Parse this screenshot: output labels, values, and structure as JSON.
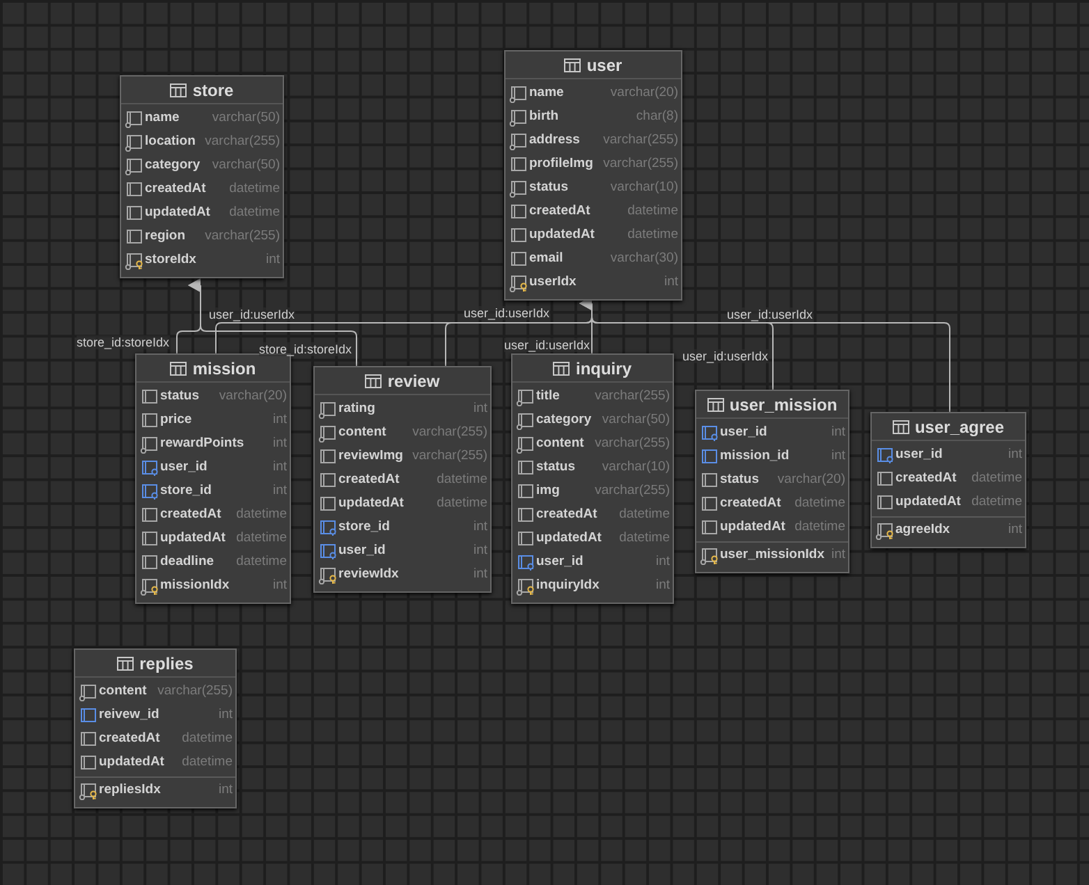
{
  "tables": [
    {
      "name": "store",
      "key_divider": false,
      "columns": [
        {
          "name": "name",
          "type": "varchar(50)",
          "kind": "required"
        },
        {
          "name": "location",
          "type": "varchar(255)",
          "kind": "required"
        },
        {
          "name": "category",
          "type": "varchar(50)",
          "kind": "required"
        },
        {
          "name": "createdAt",
          "type": "datetime",
          "kind": "plain"
        },
        {
          "name": "updatedAt",
          "type": "datetime",
          "kind": "plain"
        },
        {
          "name": "region",
          "type": "varchar(255)",
          "kind": "plain"
        },
        {
          "name": "storeIdx",
          "type": "int",
          "kind": "primary"
        }
      ]
    },
    {
      "name": "user",
      "key_divider": false,
      "columns": [
        {
          "name": "name",
          "type": "varchar(20)",
          "kind": "required"
        },
        {
          "name": "birth",
          "type": "char(8)",
          "kind": "required"
        },
        {
          "name": "address",
          "type": "varchar(255)",
          "kind": "required"
        },
        {
          "name": "profileImg",
          "type": "varchar(255)",
          "kind": "plain"
        },
        {
          "name": "status",
          "type": "varchar(10)",
          "kind": "required"
        },
        {
          "name": "createdAt",
          "type": "datetime",
          "kind": "plain"
        },
        {
          "name": "updatedAt",
          "type": "datetime",
          "kind": "plain"
        },
        {
          "name": "email",
          "type": "varchar(30)",
          "kind": "plain"
        },
        {
          "name": "userIdx",
          "type": "int",
          "kind": "primary"
        }
      ]
    },
    {
      "name": "mission",
      "key_divider": false,
      "columns": [
        {
          "name": "status",
          "type": "varchar(20)",
          "kind": "plain"
        },
        {
          "name": "price",
          "type": "int",
          "kind": "plain"
        },
        {
          "name": "rewardPoints",
          "type": "int",
          "kind": "required"
        },
        {
          "name": "user_id",
          "type": "int",
          "kind": "foreign"
        },
        {
          "name": "store_id",
          "type": "int",
          "kind": "foreign"
        },
        {
          "name": "createdAt",
          "type": "datetime",
          "kind": "plain"
        },
        {
          "name": "updatedAt",
          "type": "datetime",
          "kind": "plain"
        },
        {
          "name": "deadline",
          "type": "datetime",
          "kind": "plain"
        },
        {
          "name": "missionIdx",
          "type": "int",
          "kind": "primary"
        }
      ]
    },
    {
      "name": "review",
      "key_divider": false,
      "columns": [
        {
          "name": "rating",
          "type": "int",
          "kind": "required"
        },
        {
          "name": "content",
          "type": "varchar(255)",
          "kind": "required"
        },
        {
          "name": "reviewImg",
          "type": "varchar(255)",
          "kind": "plain"
        },
        {
          "name": "createdAt",
          "type": "datetime",
          "kind": "plain"
        },
        {
          "name": "updatedAt",
          "type": "datetime",
          "kind": "plain"
        },
        {
          "name": "store_id",
          "type": "int",
          "kind": "foreign"
        },
        {
          "name": "user_id",
          "type": "int",
          "kind": "foreign"
        },
        {
          "name": "reviewIdx",
          "type": "int",
          "kind": "primary"
        }
      ]
    },
    {
      "name": "inquiry",
      "key_divider": false,
      "columns": [
        {
          "name": "title",
          "type": "varchar(255)",
          "kind": "required"
        },
        {
          "name": "category",
          "type": "varchar(50)",
          "kind": "required"
        },
        {
          "name": "content",
          "type": "varchar(255)",
          "kind": "required"
        },
        {
          "name": "status",
          "type": "varchar(10)",
          "kind": "plain"
        },
        {
          "name": "img",
          "type": "varchar(255)",
          "kind": "plain"
        },
        {
          "name": "createdAt",
          "type": "datetime",
          "kind": "plain"
        },
        {
          "name": "updatedAt",
          "type": "datetime",
          "kind": "plain"
        },
        {
          "name": "user_id",
          "type": "int",
          "kind": "foreign"
        },
        {
          "name": "inquiryIdx",
          "type": "int",
          "kind": "primary"
        }
      ]
    },
    {
      "name": "user_mission",
      "key_divider": true,
      "columns": [
        {
          "name": "user_id",
          "type": "int",
          "kind": "foreign"
        },
        {
          "name": "mission_id",
          "type": "int",
          "kind": "reference"
        },
        {
          "name": "status",
          "type": "varchar(20)",
          "kind": "plain"
        },
        {
          "name": "createdAt",
          "type": "datetime",
          "kind": "plain"
        },
        {
          "name": "updatedAt",
          "type": "datetime",
          "kind": "plain"
        },
        {
          "name": "user_missionIdx",
          "type": "int",
          "kind": "primary"
        }
      ]
    },
    {
      "name": "user_agree",
      "key_divider": true,
      "columns": [
        {
          "name": "user_id",
          "type": "int",
          "kind": "foreign"
        },
        {
          "name": "createdAt",
          "type": "datetime",
          "kind": "plain"
        },
        {
          "name": "updatedAt",
          "type": "datetime",
          "kind": "plain"
        },
        {
          "name": "agreeIdx",
          "type": "int",
          "kind": "primary"
        }
      ]
    },
    {
      "name": "replies",
      "key_divider": true,
      "columns": [
        {
          "name": "content",
          "type": "varchar(255)",
          "kind": "required"
        },
        {
          "name": "reivew_id",
          "type": "int",
          "kind": "reference"
        },
        {
          "name": "createdAt",
          "type": "datetime",
          "kind": "plain"
        },
        {
          "name": "updatedAt",
          "type": "datetime",
          "kind": "plain"
        },
        {
          "name": "repliesIdx",
          "type": "int",
          "kind": "primary"
        }
      ]
    }
  ],
  "relations": [
    {
      "label": "user_id:userIdx"
    },
    {
      "label": "store_id:storeIdx"
    },
    {
      "label": "store_id:storeIdx"
    },
    {
      "label": "user_id:userIdx"
    },
    {
      "label": "user_id:userIdx"
    },
    {
      "label": "user_id:userIdx"
    },
    {
      "label": "user_id:userIdx"
    }
  ]
}
